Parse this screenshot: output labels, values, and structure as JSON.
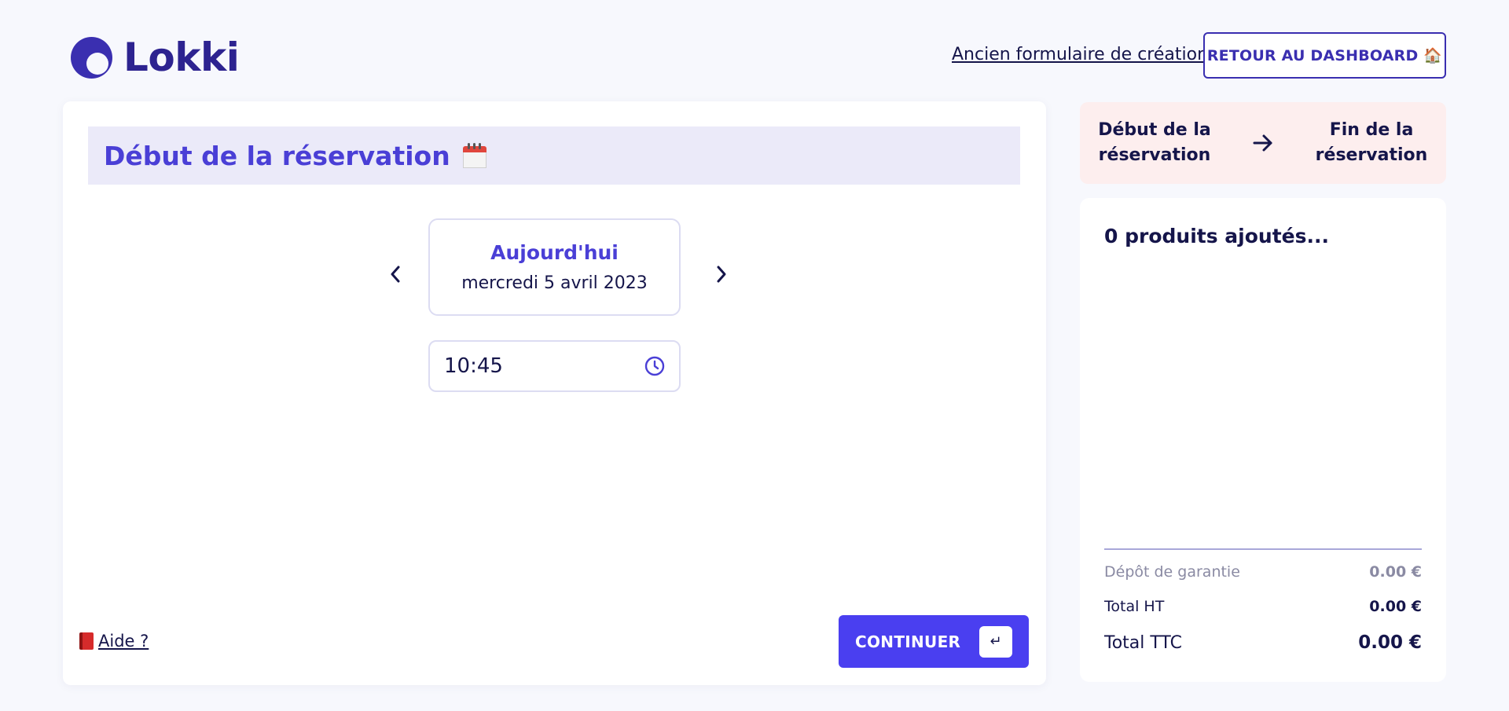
{
  "header": {
    "logo_text": "Lokki",
    "old_form_link": "Ancien formulaire de création",
    "dashboard_button": "RETOUR AU DASHBOARD 🏠"
  },
  "main": {
    "section_title": "Début de la réservation",
    "date": {
      "label": "Aujourd'hui",
      "full": "mercredi 5 avril 2023"
    },
    "time": {
      "value": "10:45"
    },
    "help_link": "Aide ?",
    "continue_label": "CONTINUER",
    "enter_key": "↵"
  },
  "steps": {
    "start": "Début de la réservation",
    "end": "Fin de la réservation"
  },
  "cart": {
    "title": "0 produits ajoutés...",
    "deposit_label": "Dépôt de garantie",
    "deposit_value": "0.00 €",
    "total_ht_label": "Total HT",
    "total_ht_value": "0.00 €",
    "total_ttc_label": "Total TTC",
    "total_ttc_value": "0.00 €"
  },
  "colors": {
    "brand": "#3a2fb0",
    "accent": "#4a3ff0",
    "title_bar": "#ebeaf9",
    "steps_bg": "#fdeeee"
  }
}
